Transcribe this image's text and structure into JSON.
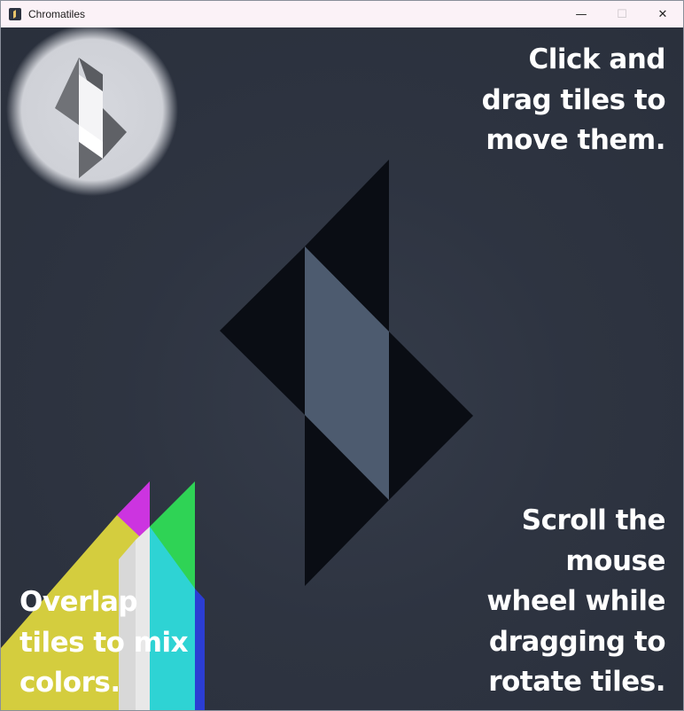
{
  "window": {
    "title": "Chromatiles",
    "controls": {
      "minimize": "—",
      "maximize": "☐",
      "close": "✕"
    }
  },
  "hints": {
    "drag": [
      "Click and",
      "drag tiles to",
      "move them."
    ],
    "rotate": [
      "Scroll the",
      "mouse",
      "wheel while",
      "dragging to",
      "rotate tiles."
    ],
    "mix": [
      "Overlap",
      "tiles to mix",
      "colors."
    ]
  },
  "colors": {
    "background": "#2b3140",
    "dark_tile": "#0a0d14",
    "slate_tile": "#4d5b6f",
    "red_tile": "#d6344f",
    "green_tile": "#2fd355",
    "yellow_tile": "#d4cd3e",
    "cyan_tile": "#2ed3d4",
    "blue_tile": "#2b3dd3",
    "magenta_mix": "#cc34e0",
    "logo_bg": "#d2d4da"
  }
}
